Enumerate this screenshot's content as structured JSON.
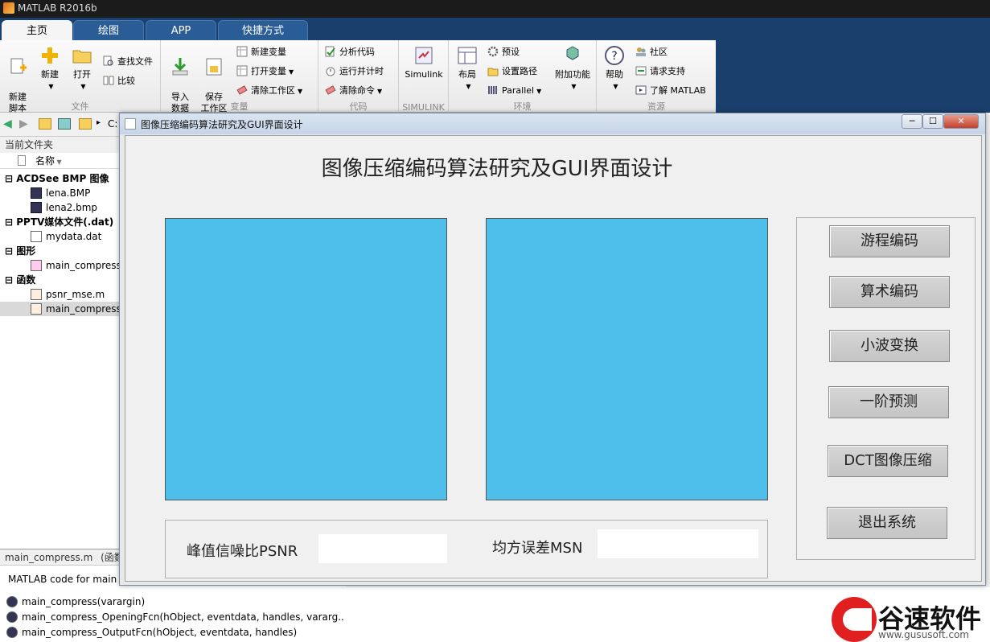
{
  "app": {
    "title": "MATLAB R2016b"
  },
  "tabs": [
    {
      "label": "主页"
    },
    {
      "label": "绘图"
    },
    {
      "label": "APP"
    },
    {
      "label": "快捷方式"
    }
  ],
  "ribbon": {
    "file": {
      "group_label": "文件",
      "new_script": "新建\n脚本",
      "new": "新建",
      "open": "打开",
      "find_files": "查找文件",
      "compare": "比较"
    },
    "variable": {
      "group_label": "变量",
      "import": "导入\n数据",
      "save_ws": "保存\n工作区",
      "new_var": "新建变量",
      "open_var": "打开变量",
      "clear_ws": "清除工作区"
    },
    "code": {
      "group_label": "代码",
      "analyze": "分析代码",
      "run_time": "运行并计时",
      "clear_cmd": "清除命令"
    },
    "simulink": {
      "group_label": "SIMULINK",
      "label": "Simulink"
    },
    "env": {
      "group_label": "环境",
      "layout": "布局",
      "prefs": "预设",
      "set_path": "设置路径",
      "parallel": "Parallel",
      "addons": "附加功能"
    },
    "resources": {
      "group_label": "资源",
      "help": "帮助",
      "community": "社区",
      "support": "请求支持",
      "learn": "了解 MATLAB"
    }
  },
  "nav": {
    "path": "C:"
  },
  "file_panel": {
    "header": "当前文件夹",
    "col_name": "名称",
    "groups": [
      {
        "label": "ACDSee BMP 图像",
        "files": [
          "lena.BMP",
          "lena2.bmp"
        ]
      },
      {
        "label": "PPTV媒体文件(.dat)",
        "files": [
          "mydata.dat"
        ]
      },
      {
        "label": "图形",
        "files": [
          "main_compress"
        ]
      },
      {
        "label": "函数",
        "files": [
          "psnr_mse.m",
          "main_compress"
        ]
      }
    ]
  },
  "details": {
    "file_label": "main_compress.m",
    "type_label": "(函数",
    "desc": "MATLAB code for main",
    "functions": [
      "main_compress(varargin)",
      "main_compress_OpeningFcn(hObject, eventdata, handles, vararg...",
      "main_compress_OutputFcn(hObject, eventdata, handles)"
    ]
  },
  "gui": {
    "window_title": "图像压缩编码算法研究及GUI界面设计",
    "heading": "图像压缩编码算法研究及GUI界面设计",
    "buttons": [
      "游程编码",
      "算术编码",
      "小波变换",
      "一阶预测",
      "DCT图像压缩",
      "退出系统"
    ],
    "psnr_label": "峰值信噪比PSNR",
    "mse_label": "均方误差MSN",
    "psnr_value": "",
    "mse_value": "",
    "axes_color": "#4dbfea"
  },
  "brand": {
    "name": "谷速软件",
    "url": "www.gususoft.com"
  }
}
